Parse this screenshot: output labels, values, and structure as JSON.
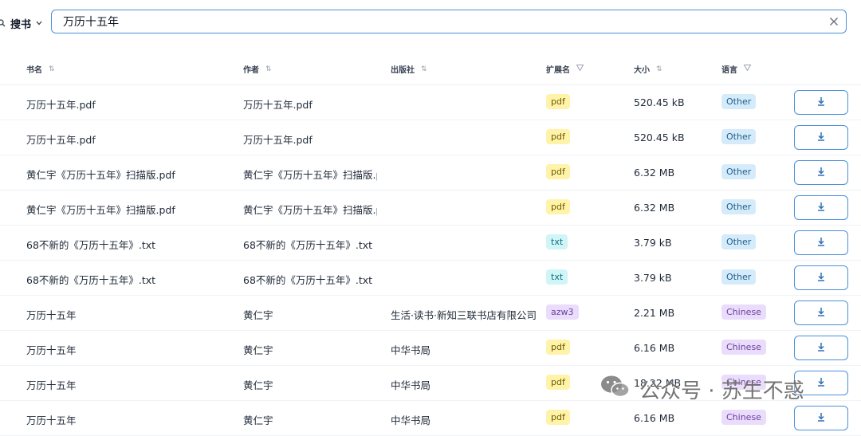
{
  "search": {
    "mode_label": "搜书",
    "query": "万历十五年"
  },
  "table": {
    "headers": {
      "title": "书名",
      "author": "作者",
      "publisher": "出版社",
      "extension": "扩展名",
      "size": "大小",
      "language": "语言"
    },
    "rows": [
      {
        "title": "万历十五年.pdf",
        "author": "万历十五年.pdf",
        "publisher": "",
        "extension": "pdf",
        "size": "520.45 kB",
        "language": "Other"
      },
      {
        "title": "万历十五年.pdf",
        "author": "万历十五年.pdf",
        "publisher": "",
        "extension": "pdf",
        "size": "520.45 kB",
        "language": "Other"
      },
      {
        "title": "黄仁宇《万历十五年》扫描版.pdf",
        "author": "黄仁宇《万历十五年》扫描版.p",
        "publisher": "",
        "extension": "pdf",
        "size": "6.32 MB",
        "language": "Other"
      },
      {
        "title": "黄仁宇《万历十五年》扫描版.pdf",
        "author": "黄仁宇《万历十五年》扫描版.p",
        "publisher": "",
        "extension": "pdf",
        "size": "6.32 MB",
        "language": "Other"
      },
      {
        "title": "68不新的《万历十五年》.txt",
        "author": "68不新的《万历十五年》.txt",
        "publisher": "",
        "extension": "txt",
        "size": "3.79 kB",
        "language": "Other"
      },
      {
        "title": "68不新的《万历十五年》.txt",
        "author": "68不新的《万历十五年》.txt",
        "publisher": "",
        "extension": "txt",
        "size": "3.79 kB",
        "language": "Other"
      },
      {
        "title": "万历十五年",
        "author": "黄仁宇",
        "publisher": "生活·读书·新知三联书店有限公司",
        "extension": "azw3",
        "size": "2.21 MB",
        "language": "Chinese"
      },
      {
        "title": "万历十五年",
        "author": "黄仁宇",
        "publisher": "中华书局",
        "extension": "pdf",
        "size": "6.16 MB",
        "language": "Chinese"
      },
      {
        "title": "万历十五年",
        "author": "黄仁宇",
        "publisher": "中华书局",
        "extension": "pdf",
        "size": "18.22 MB",
        "language": "Chinese"
      },
      {
        "title": "万历十五年",
        "author": "黄仁宇",
        "publisher": "中华书局",
        "extension": "pdf",
        "size": "6.16 MB",
        "language": "Chinese"
      }
    ]
  },
  "watermark": {
    "text": "公众号 · 苏生不惑"
  },
  "icons": {
    "search": "search-icon",
    "chevron": "chevron-down-icon",
    "clear": "close-icon",
    "sort": "sort-icon",
    "filter": "filter-icon",
    "download": "download-icon",
    "wechat": "wechat-icon"
  },
  "colors": {
    "accent": "#4a90d9",
    "pdf_badge": "#fef3a8",
    "txt_badge": "#cff5f7",
    "azw3_badge": "#eadcfb",
    "other_badge": "#d5ebfa",
    "chinese_badge": "#eadcfb"
  }
}
